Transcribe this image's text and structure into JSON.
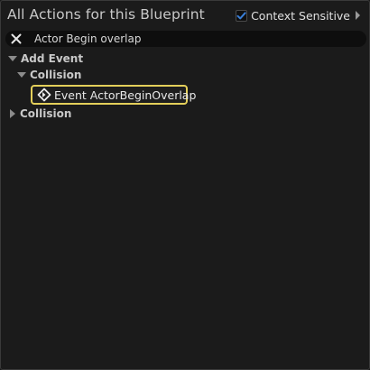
{
  "header": {
    "title": "All Actions for this Blueprint",
    "context_sensitive_label": "Context Sensitive",
    "context_sensitive_checked": true
  },
  "search": {
    "value": "Actor Begin overlap"
  },
  "tree": {
    "add_event": {
      "label": "Add Event",
      "expanded": true,
      "collision": {
        "label": "Collision",
        "expanded": true,
        "items": [
          {
            "label": "Event ActorBeginOverlap",
            "icon": "event-diamond-icon",
            "selected": true
          }
        ]
      }
    },
    "collision": {
      "label": "Collision",
      "expanded": false
    }
  },
  "colors": {
    "background": "#1b1b1b",
    "selection_border": "#e4cf5a",
    "checkbox_check": "#3a7fd8"
  }
}
